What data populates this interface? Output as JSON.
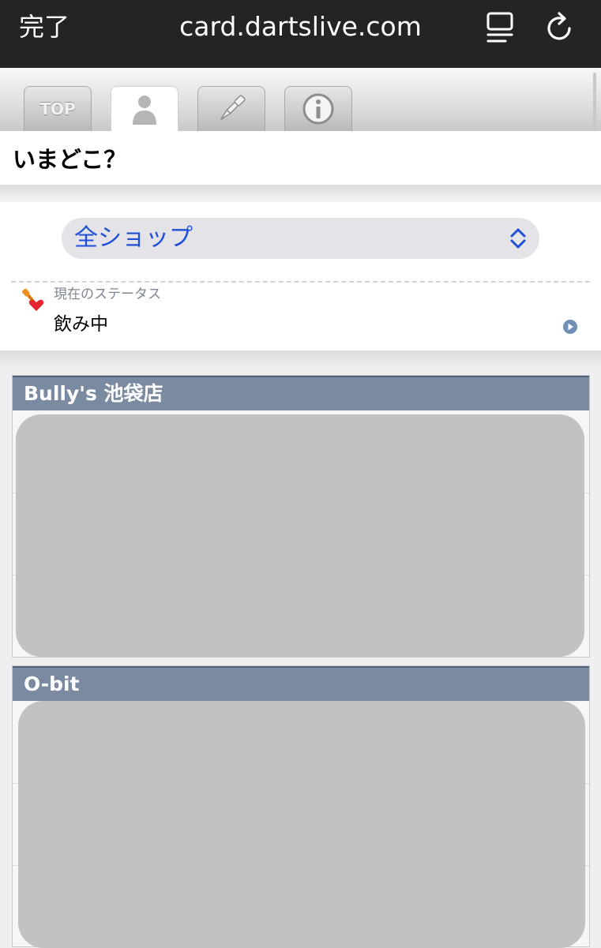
{
  "browser": {
    "done_label": "完了",
    "url": "card.dartslive.com"
  },
  "tabs": [
    {
      "label": "TOP",
      "icon": "top-icon"
    },
    {
      "icon": "person-icon",
      "active": true
    },
    {
      "icon": "dart-icon"
    },
    {
      "icon": "info-icon"
    }
  ],
  "page": {
    "title": "いまどこ？"
  },
  "status_panel": {
    "shop_select_value": "全ショップ",
    "status_label": "現在のステータス",
    "status_value": "飲み中"
  },
  "shops": [
    {
      "name": "Bully's 池袋店"
    },
    {
      "name": "O-bit"
    }
  ],
  "colors": {
    "topbar": "#242424",
    "select_text": "#1f4fd6",
    "shop_header": "#7a8ba1",
    "redacted_block": "#c2c2c2"
  }
}
